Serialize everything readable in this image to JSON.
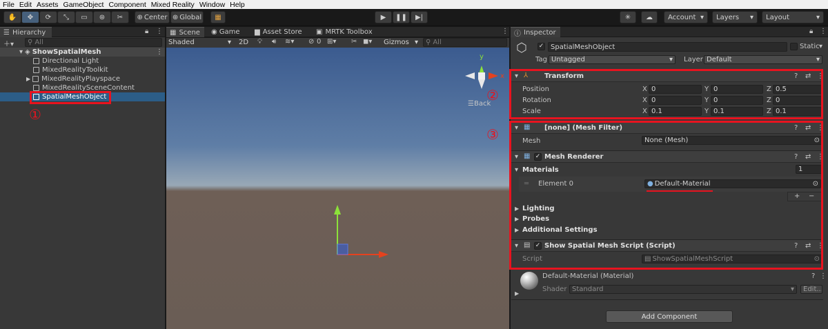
{
  "menu": [
    "File",
    "Edit",
    "Assets",
    "GameObject",
    "Component",
    "Mixed Reality",
    "Window",
    "Help"
  ],
  "toolbar": {
    "pivot": "Center",
    "space": "Global",
    "account": "Account",
    "layers": "Layers",
    "layout": "Layout"
  },
  "hierarchy": {
    "tab": "Hierarchy",
    "search_placeholder": "All",
    "scene": "ShowSpatialMesh",
    "items": [
      "Directional Light",
      "MixedRealityToolkit",
      "MixedRealityPlayspace",
      "MixedRealitySceneContent",
      "SpatialMeshObject"
    ]
  },
  "scene_view": {
    "tabs": [
      "Scene",
      "Game",
      "Asset Store",
      "MRTK Toolbox"
    ],
    "shading": "Shaded",
    "mode2d": "2D",
    "hidden_count": "0",
    "gizmos": "Gizmos",
    "search_placeholder": "All",
    "axis_y": "y",
    "axis_x": "x",
    "view_label": "Back"
  },
  "inspector": {
    "tab": "Inspector",
    "object_name": "SpatialMeshObject",
    "static_label": "Static",
    "tag_label": "Tag",
    "tag_value": "Untagged",
    "layer_label": "Layer",
    "layer_value": "Default",
    "transform": {
      "title": "Transform",
      "position_label": "Position",
      "rotation_label": "Rotation",
      "scale_label": "Scale",
      "position": [
        "0",
        "0",
        "0.5"
      ],
      "rotation": [
        "0",
        "0",
        "0"
      ],
      "scale": [
        "0.1",
        "0.1",
        "0.1"
      ],
      "axes": [
        "X",
        "Y",
        "Z"
      ]
    },
    "mesh_filter": {
      "title": "[none] (Mesh Filter)",
      "mesh_label": "Mesh",
      "mesh_value": "None (Mesh)"
    },
    "mesh_renderer": {
      "title": "Mesh Renderer",
      "materials_label": "Materials",
      "materials_count": "1",
      "element_label": "Element 0",
      "element_value": "Default-Material",
      "plus": "+",
      "minus": "−",
      "lighting": "Lighting",
      "probes": "Probes",
      "additional": "Additional Settings"
    },
    "script_comp": {
      "title": "Show Spatial Mesh Script (Script)",
      "script_label": "Script",
      "script_value": "ShowSpatialMeshScript"
    },
    "material": {
      "name": "Default-Material (Material)",
      "shader_label": "Shader",
      "shader_value": "Standard",
      "edit": "Edit..."
    },
    "add_component": "Add Component"
  },
  "annotations": {
    "one": "①",
    "two": "②",
    "three": "③"
  },
  "colors": {
    "annotation": "#e8131f",
    "selection": "#2c5d87",
    "sky_top": "#3d5f93",
    "ground": "#6e5f56"
  }
}
